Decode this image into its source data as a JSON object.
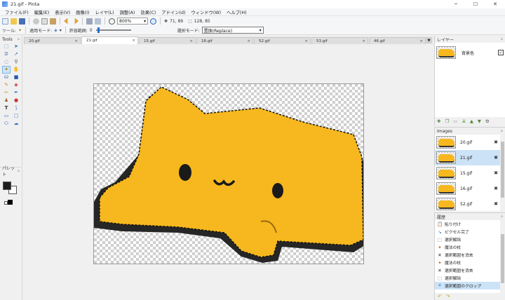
{
  "window": {
    "title": "21.gif - Pinta",
    "minimize": "─",
    "maximize": "☐",
    "close": "✕"
  },
  "menu": [
    "ファイル(F)",
    "編集(E)",
    "表示(V)",
    "画像(I)",
    "レイヤ(L)",
    "調整(A)",
    "効果(C)",
    "アドイン(d)",
    "ウィンドウ(W)",
    "ヘルプ(H)"
  ],
  "toolbar": {
    "zoom_value": "800%",
    "cursor_position": "71, 89",
    "selection_size": "128, 85"
  },
  "toolbar2": {
    "tool_label": "ツール:",
    "flood_mode_label": "適用モード:",
    "tolerance_label": "許容範囲:",
    "tolerance_value": "0",
    "selection_mode_label": "選択モード:",
    "selection_mode_value": "置換(Replace)"
  },
  "tools_panel": {
    "title": "Tools"
  },
  "palette_panel": {
    "title": "パレット"
  },
  "tabs": [
    {
      "label": "20.gif",
      "close": "×"
    },
    {
      "label": "21.gif",
      "close": "×"
    },
    {
      "label": "15.gif",
      "close": "×"
    },
    {
      "label": "16.gif",
      "close": "×"
    },
    {
      "label": "52.gif",
      "close": "×"
    },
    {
      "label": "53.gif",
      "close": "×"
    },
    {
      "label": "46.gif",
      "close": "×"
    }
  ],
  "layers_panel": {
    "title": "レイヤー",
    "layer_name": "背景色",
    "visible_check": "✓"
  },
  "images_panel": {
    "title": "Images",
    "items": [
      {
        "name": "20.gif",
        "close": "✖"
      },
      {
        "name": "21.gif",
        "close": "✖"
      },
      {
        "name": "15.gif",
        "close": "✖"
      },
      {
        "name": "16.gif",
        "close": "✖"
      },
      {
        "name": "52.gif",
        "close": "✖"
      }
    ]
  },
  "history_panel": {
    "title": "履歴",
    "items": [
      {
        "icon": "paste-icon",
        "glyph": "📋",
        "label": "貼り付け"
      },
      {
        "icon": "finish-pixels-icon",
        "glyph": "↘",
        "label": "ピクセル完了"
      },
      {
        "icon": "deselect-icon",
        "glyph": "⬚",
        "label": "選択解除"
      },
      {
        "icon": "magic-wand-icon",
        "glyph": "✦",
        "label": "魔法の杖"
      },
      {
        "icon": "erase-selection-icon",
        "glyph": "✕",
        "label": "選択範囲を消去"
      },
      {
        "icon": "magic-wand-icon",
        "glyph": "✦",
        "label": "魔法の杖"
      },
      {
        "icon": "erase-selection-icon",
        "glyph": "✕",
        "label": "選択範囲を消去"
      },
      {
        "icon": "deselect-icon",
        "glyph": "⬚",
        "label": "選択解除"
      },
      {
        "icon": "crop-selection-icon",
        "glyph": "⌗",
        "label": "選択範囲のクロップ"
      }
    ]
  },
  "colors": {
    "accent": "#1e6bd6",
    "cat_yellow": "#f6b81e",
    "selection_bg": "#cce3f7"
  }
}
